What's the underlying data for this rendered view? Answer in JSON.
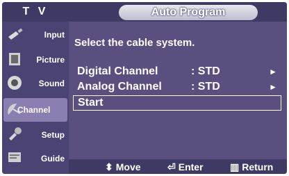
{
  "header": {
    "tv_label": "T V",
    "title": "Auto Program"
  },
  "sidebar": {
    "items": [
      {
        "label": "Input",
        "icon": "input-plug-icon"
      },
      {
        "label": "Picture",
        "icon": "picture-film-icon"
      },
      {
        "label": "Sound",
        "icon": "sound-speaker-icon"
      },
      {
        "label": "Channel",
        "icon": "channel-satellite-icon"
      },
      {
        "label": "Setup",
        "icon": "setup-wrench-icon"
      },
      {
        "label": "Guide",
        "icon": "guide-program-icon"
      }
    ]
  },
  "main": {
    "prompt": "Select the cable system.",
    "rows": [
      {
        "name": "Digital Channel",
        "value": ": STD",
        "arrow": "►"
      },
      {
        "name": "Analog Channel",
        "value": ": STD",
        "arrow": "►"
      },
      {
        "name": "Start",
        "value": "",
        "arrow": ""
      }
    ]
  },
  "footer": {
    "move_label": "Move",
    "enter_label": "Enter",
    "return_label": "Return"
  },
  "colors": {
    "panel": "#5b4f80",
    "sidebar": "#4a4374",
    "bar": "#3e3a64",
    "highlight": "#8a7fb0"
  }
}
